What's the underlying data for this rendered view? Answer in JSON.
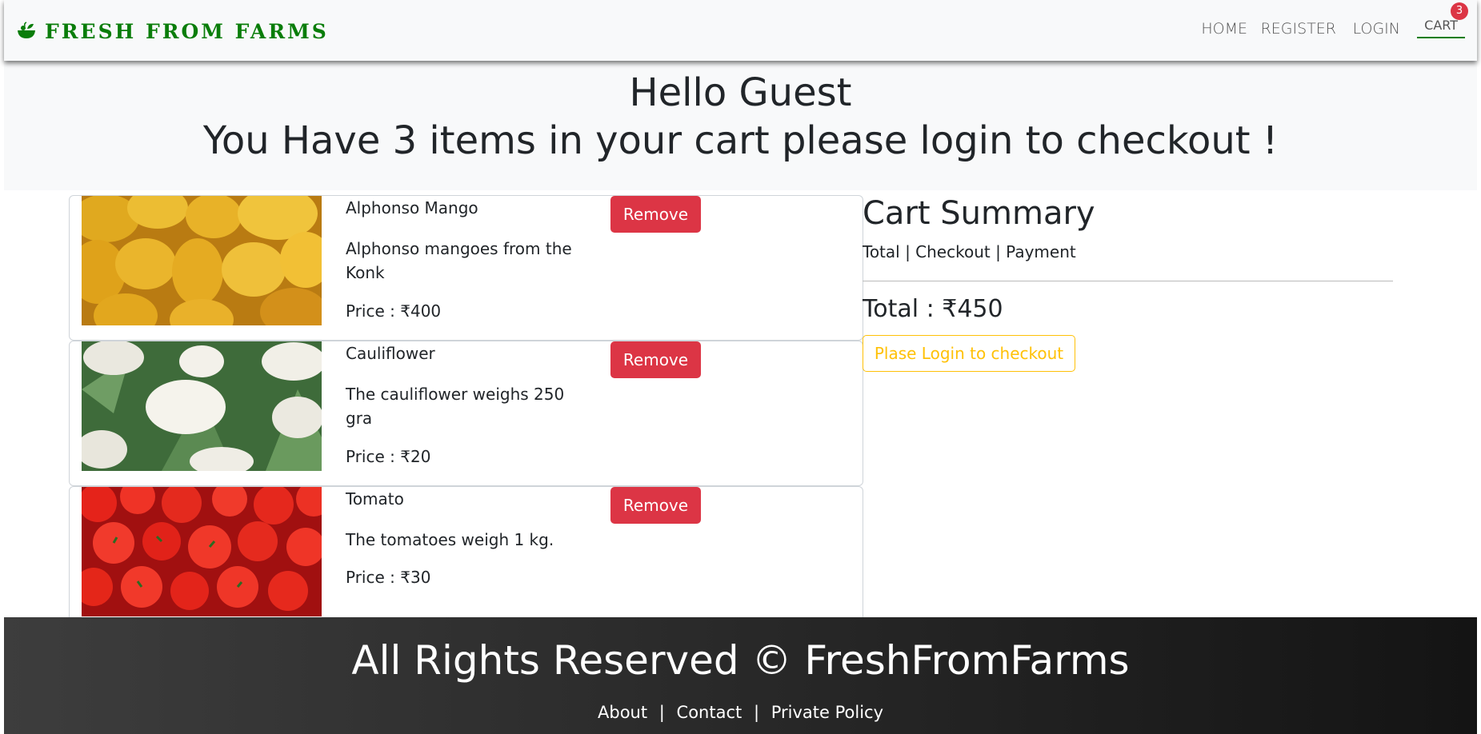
{
  "brand": {
    "name": "FRESH FROM FARMS",
    "icon": "basket-icon",
    "color": "#0a7d0a"
  },
  "nav": {
    "home": "HOME",
    "register": "REGISTER",
    "login": "LOGIN",
    "cart": "CART",
    "cart_count": "3"
  },
  "hero": {
    "greeting": "Hello Guest",
    "message": "You Have 3 items in your cart please login to checkout !"
  },
  "items": [
    {
      "name": "Alphonso Mango",
      "description": "Alphonso mangoes from the Konk",
      "price": "Price : ₹400",
      "remove": "Remove",
      "image": "mangoes-photo"
    },
    {
      "name": "Cauliflower",
      "description": "The cauliflower weighs 250 gra",
      "price": "Price : ₹20",
      "remove": "Remove",
      "image": "cauliflower-photo"
    },
    {
      "name": "Tomato",
      "description": "The tomatoes weigh 1 kg.",
      "price": "Price : ₹30",
      "remove": "Remove",
      "image": "tomatoes-photo"
    }
  ],
  "summary": {
    "title": "Cart Summary",
    "subtitle": "Total | Checkout | Payment",
    "total": "Total : ₹450",
    "login_button": "Plase Login to checkout"
  },
  "footer": {
    "copyright": "All Rights Reserved © FreshFromFarms",
    "links": [
      "About",
      "Contact",
      "Private Policy"
    ],
    "separator": "|"
  },
  "colors": {
    "danger": "#dc3545",
    "warning": "#ffc107",
    "navbar_bg": "#f8f9fa"
  }
}
